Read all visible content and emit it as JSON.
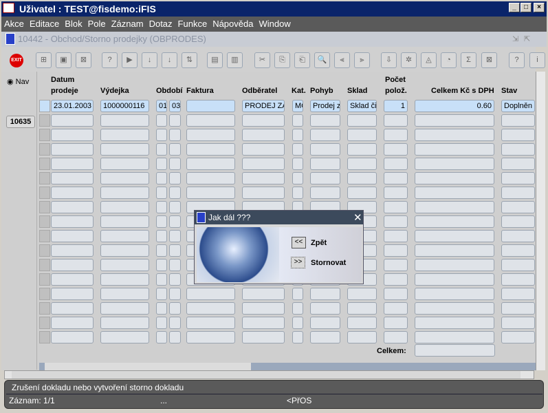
{
  "window": {
    "title": "Uživatel : TEST@fisdemo:iFIS"
  },
  "menu": [
    "Akce",
    "Editace",
    "Blok",
    "Pole",
    "Záznam",
    "Dotaz",
    "Funkce",
    "Nápověda",
    "Window"
  ],
  "form": {
    "title": "10442 - Obchod/Storno prodejky (OBPRODES)"
  },
  "toolbar": {
    "exit_label": "EXIT",
    "icons": [
      "insert-record-icon",
      "save-icon",
      "delete-record-icon",
      "query-icon",
      "execute-query-icon",
      "sort-asc-icon",
      "sort-desc-icon",
      "sort-multi-icon",
      "print-icon",
      "print-preview-icon",
      "cut-icon",
      "copy-icon",
      "paste-icon",
      "find-icon",
      "column-left-icon",
      "column-right-icon",
      "export-icon",
      "filter-icon",
      "eye-icon",
      "calendar-icon",
      "sum-icon",
      "excel-icon",
      "help-icon",
      "info-icon"
    ]
  },
  "nav": {
    "radio_label": "Nav",
    "record_id": "10635"
  },
  "columns": {
    "datum_1": "Datum",
    "datum_2": "prodeje",
    "vydejka": "Výdejka",
    "obdobi": "Období",
    "faktura": "Faktura",
    "odberatel": "Odběratel",
    "kat": "Kat.",
    "pohyb": "Pohyb",
    "sklad": "Sklad",
    "pocet_1": "Počet",
    "pocet_2": "polož.",
    "celkem": "Celkem Kč s DPH",
    "stav": "Stav"
  },
  "row1": {
    "datum": "23.01.2003",
    "vydejka": "1000000116",
    "obdobi_m": "01",
    "obdobi_y": "03",
    "faktura": "",
    "odberatel": "PRODEJ ZA",
    "kat": "MC",
    "pohyb": "Prodej za",
    "sklad": "Sklad čis",
    "pocet": "1",
    "celkem": "0.60",
    "stav": "Doplněn"
  },
  "footer": {
    "celkem_label": "Celkem:",
    "celkem_value": ""
  },
  "dialog": {
    "title": "Jak dál ???",
    "back_btn": "<<",
    "back_label": "Zpět",
    "storno_btn": ">>",
    "storno_label": "Stornovat"
  },
  "status": {
    "message": "Zrušení dokladu nebo vytvoření storno dokladu",
    "record": "Záznam: 1/1",
    "ellipsis": "...",
    "mode": "<PřOS"
  }
}
